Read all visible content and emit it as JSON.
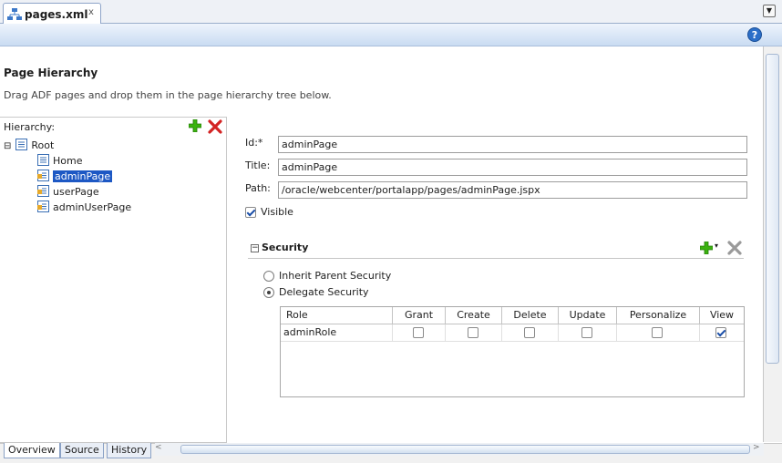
{
  "tab": {
    "title": "pages.xml",
    "close": "x",
    "menu": "▼"
  },
  "toolbar": {
    "help": "?"
  },
  "header": {
    "title": "Page Hierarchy",
    "description": "Drag ADF pages and drop them in the page hierarchy tree below."
  },
  "hierarchy": {
    "label": "Hierarchy:",
    "items": [
      {
        "label": "Root",
        "expander": "⊟"
      },
      {
        "label": "Home"
      },
      {
        "label": "adminPage",
        "selected": true
      },
      {
        "label": "userPage"
      },
      {
        "label": "adminUserPage"
      }
    ]
  },
  "form": {
    "id_label": "Id:*",
    "id_value": "adminPage",
    "title_label": "Title:",
    "title_value": "adminPage",
    "path_label": "Path:",
    "path_value": "/oracle/webcenter/portalapp/pages/adminPage.jspx",
    "visible_label": "Visible",
    "visible_checked": true
  },
  "security": {
    "title": "Security",
    "toggle": "−",
    "options": [
      {
        "label": "Inherit Parent Security",
        "selected": false
      },
      {
        "label": "Delegate Security",
        "selected": true
      }
    ],
    "table": {
      "columns": [
        "Role",
        "Grant",
        "Create",
        "Delete",
        "Update",
        "Personalize",
        "View"
      ],
      "rows": [
        {
          "role": "adminRole",
          "grant": false,
          "create": false,
          "delete": false,
          "update": false,
          "personalize": false,
          "view": true
        }
      ]
    }
  },
  "bottom_tabs": [
    {
      "label": "Overview",
      "active": true
    },
    {
      "label": "Source",
      "active": false
    },
    {
      "label": "History",
      "active": false
    }
  ],
  "colors": {
    "accent": "#1d58c4",
    "add": "#3bb20f",
    "delete": "#d32323"
  }
}
